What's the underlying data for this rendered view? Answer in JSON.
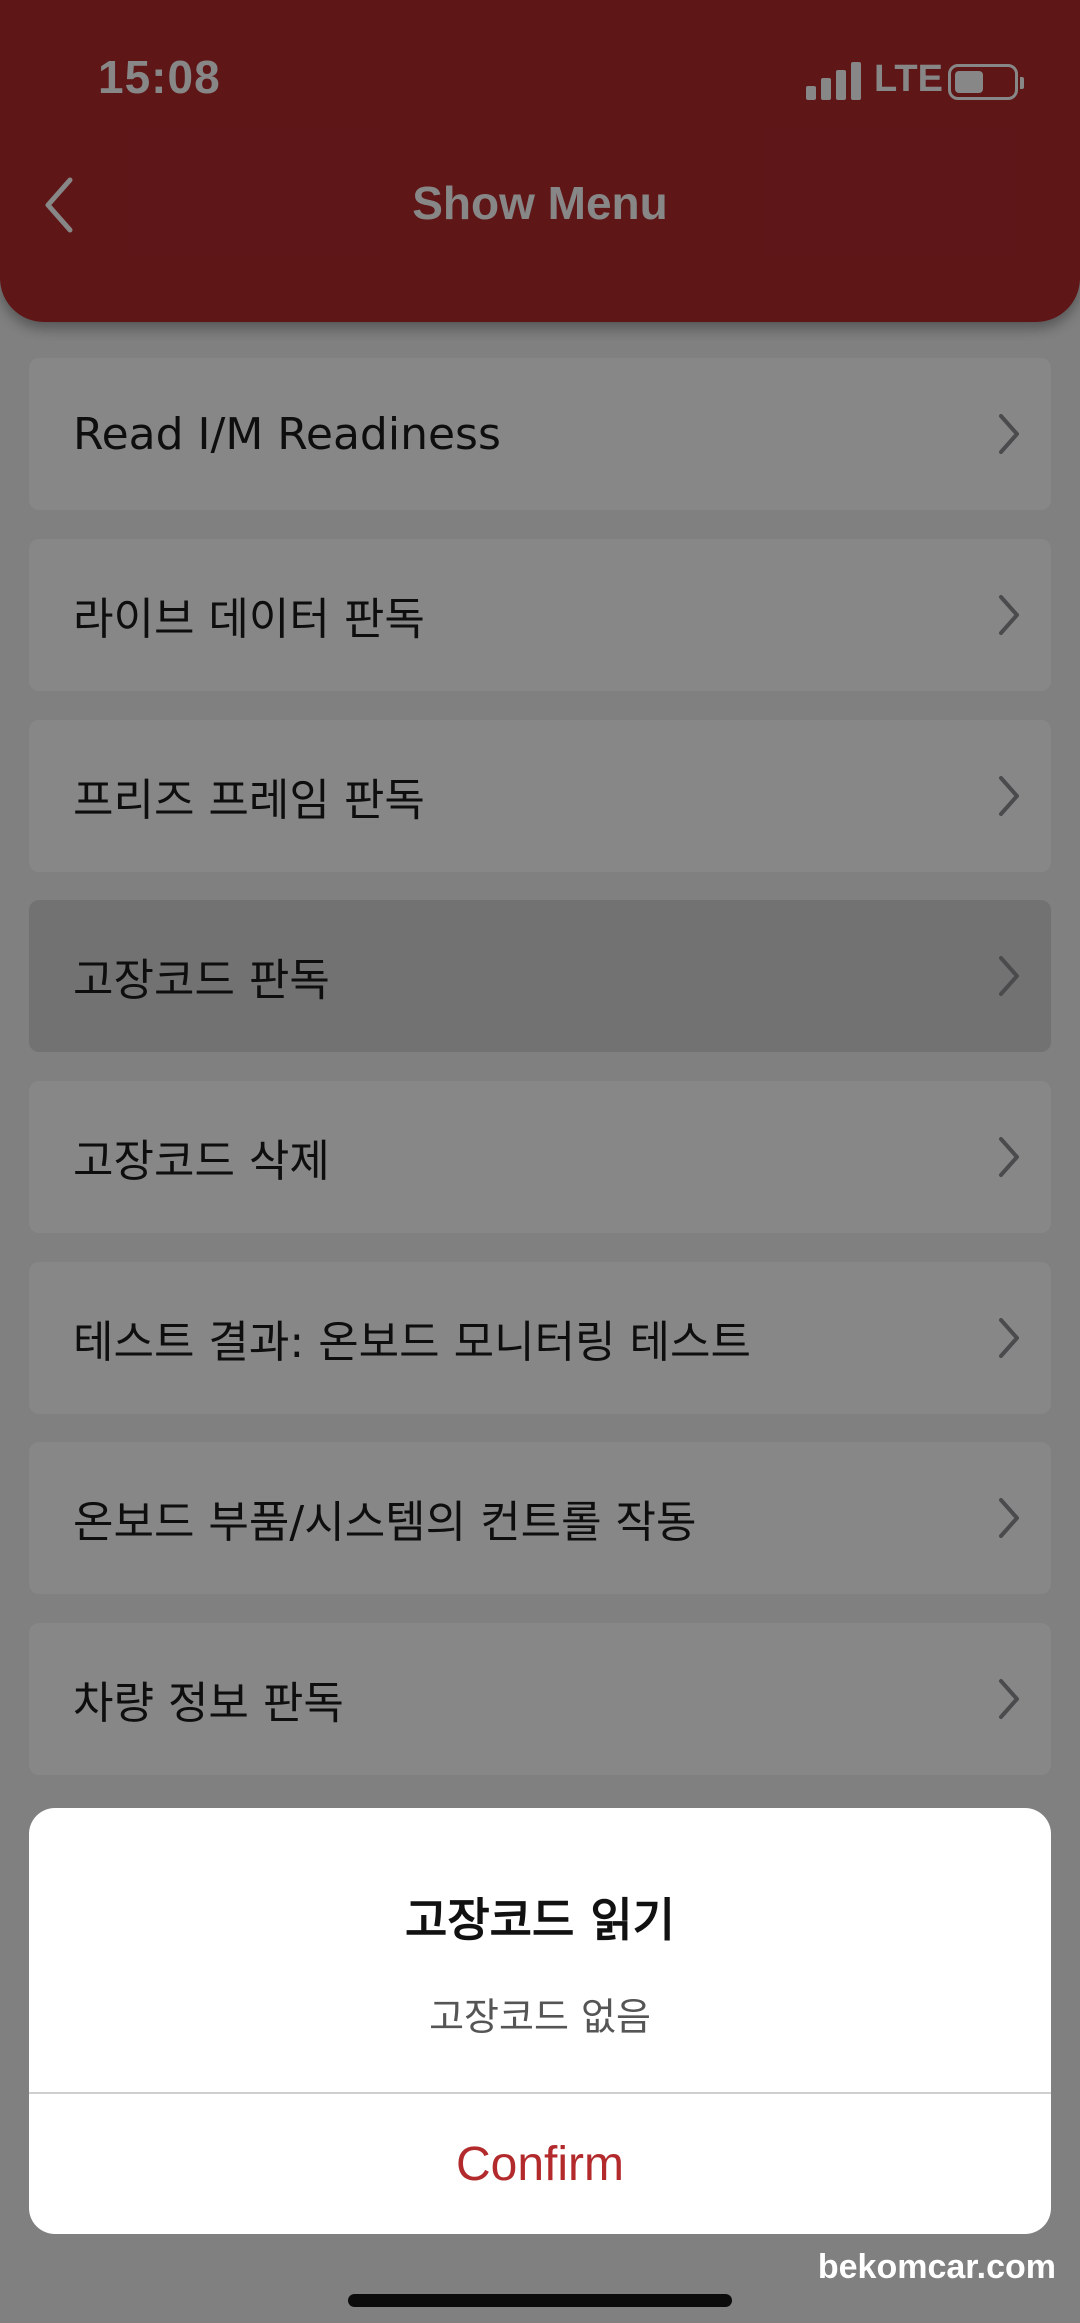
{
  "status_bar": {
    "time": "15:08",
    "network": "LTE",
    "battery_level": 0.5
  },
  "header": {
    "title": "Show Menu"
  },
  "menu": {
    "items": [
      {
        "label": "Read I/M Readiness",
        "selected": false
      },
      {
        "label": "라이브 데이터 판독",
        "selected": false
      },
      {
        "label": "프리즈 프레임 판독",
        "selected": false
      },
      {
        "label": "고장코드 판독",
        "selected": true
      },
      {
        "label": "고장코드 삭제",
        "selected": false
      },
      {
        "label": "테스트 결과: 온보드 모니터링 테스트",
        "selected": false
      },
      {
        "label": "온보드 부품/시스템의 컨트롤 작동",
        "selected": false
      },
      {
        "label": "차량 정보 판독",
        "selected": false
      }
    ]
  },
  "dialog": {
    "title": "고장코드 읽기",
    "message": "고장코드 없음",
    "confirm_label": "Confirm"
  },
  "watermark": "bekomcar.com",
  "colors": {
    "brand": "#b32a2d",
    "background": "#f2f2f2"
  }
}
